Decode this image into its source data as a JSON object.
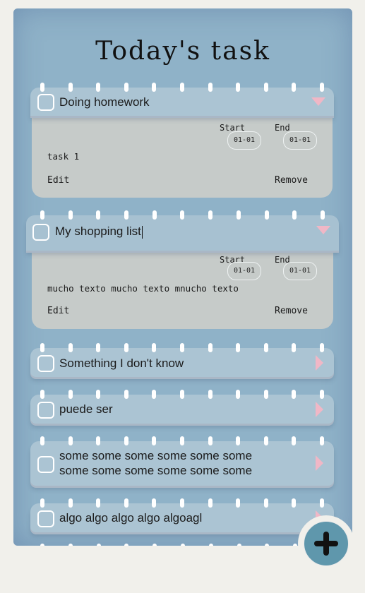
{
  "app": {
    "title": "Today's task"
  },
  "tasks": [
    {
      "label": "Doing homework",
      "expanded": true,
      "start_label": "Start",
      "end_label": "End",
      "start": "01-01",
      "end": "01-01",
      "description": "task 1",
      "edit_label": "Edit",
      "remove_label": "Remove"
    },
    {
      "label": "My shopping list",
      "expanded": true,
      "start_label": "Start",
      "end_label": "End",
      "start": "01-01",
      "end": "01-01",
      "description": "mucho texto mucho texto mnucho texto",
      "edit_label": "Edit",
      "remove_label": "Remove"
    },
    {
      "label": "Something I don't know",
      "expanded": false
    },
    {
      "label": "puede ser",
      "expanded": false
    },
    {
      "label_line1": "some some some some some some",
      "label_line2": "some some some some some some",
      "expanded": false
    },
    {
      "label": "algo algo algo algo algoagl",
      "expanded": false
    }
  ],
  "icons": {
    "add": "plus-icon",
    "expand": "triangle-down-icon",
    "collapse": "triangle-right-icon",
    "checkbox": "checkbox-icon"
  },
  "colors": {
    "board": "#8fb2c8",
    "card_header": "#abc4d3",
    "card_body": "#c6cbc9",
    "toggle": "#f0b7c6",
    "fab": "#5f97ac"
  }
}
